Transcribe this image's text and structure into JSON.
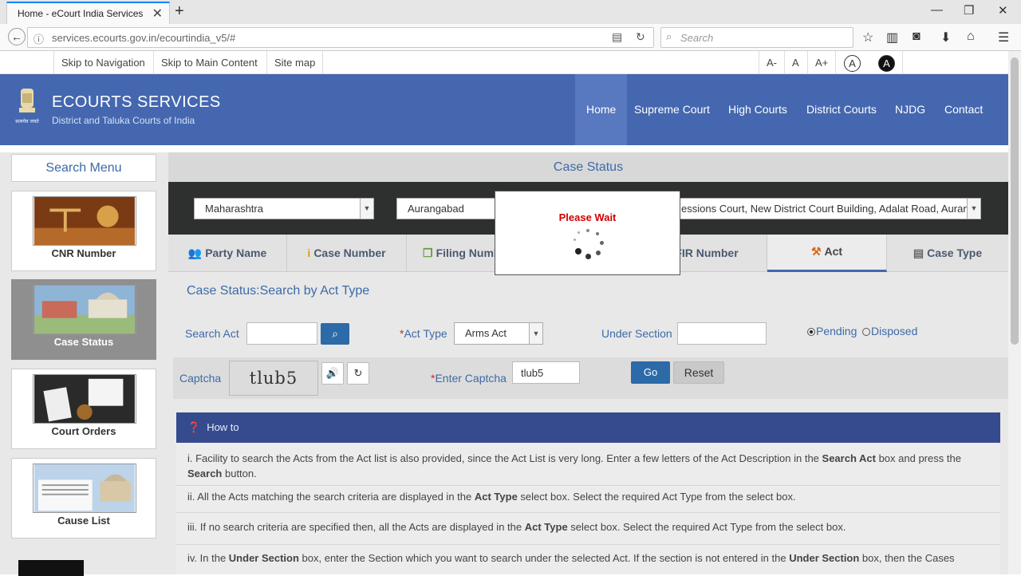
{
  "browser": {
    "tab_title": "Home - eCourt India Services",
    "url": "services.ecourts.gov.in/ecourtindia_v5/#",
    "search_placeholder": "Search"
  },
  "accessibility_bar": {
    "links": [
      "Skip to Navigation",
      "Skip to Main Content",
      "Site map"
    ],
    "font_sizes": [
      "A-",
      "A",
      "A+"
    ],
    "contrast_normal": "A",
    "contrast_high": "A"
  },
  "header": {
    "title": "ECOURTS SERVICES",
    "subtitle": "District and Taluka Courts of India",
    "emblem_caption": "सत्यमेव जयते",
    "menu": [
      "Home",
      "Supreme Court",
      "High Courts",
      "District Courts",
      "NJDG",
      "Contact Us"
    ],
    "bg_color": "#4467b0"
  },
  "sidebar": {
    "title": "Search Menu",
    "items": [
      {
        "label": "CNR Number",
        "active": false
      },
      {
        "label": "Case Status",
        "active": true
      },
      {
        "label": "Court Orders",
        "active": false
      },
      {
        "label": "Cause List",
        "active": false
      }
    ]
  },
  "main": {
    "title": "Case Status",
    "selects": {
      "state": "Maharashtra",
      "district": "Aurangabad",
      "complex": "essions Court, New District Court Building, Adalat Road, Auranga"
    },
    "tabs": [
      "Party Name",
      "Case Number",
      "Filing Number",
      "FIR Number",
      "Act",
      "Case Type"
    ],
    "active_tab": "Act",
    "heading": "Case Status:Search by Act Type",
    "form": {
      "search_act_label": "Search Act",
      "search_act_value": "",
      "act_type_label": "Act Type",
      "act_type_value": "Arms Act",
      "under_section_label": "Under Section",
      "under_section_value": "",
      "radio_pending": "Pending",
      "radio_disposed": "Disposed",
      "pending_selected": true,
      "captcha_label": "Captcha",
      "captcha_image_text": "tlub5",
      "enter_captcha_label": "Enter Captcha",
      "captcha_value": "tlub5",
      "go_label": "Go",
      "reset_label": "Reset"
    }
  },
  "howto": {
    "title": "How to",
    "items": [
      {
        "pre": "i. Facility to search the Acts from the Act list is also provided, since the Act List is very long. Enter a few letters of the Act Description in the ",
        "b1": "Search Act",
        "mid": " box and press the ",
        "b2": "Search",
        "post": " button."
      },
      {
        "pre": "ii. All the Acts matching the search criteria are displayed in the ",
        "b1": "Act Type",
        "post": " select box. Select the required Act Type from the select box."
      },
      {
        "pre": "iii. If no search criteria are specified then, all the Acts are displayed in the ",
        "b1": "Act Type",
        "post": " select box. Select the required Act Type from the select box."
      },
      {
        "pre": "iv. In the ",
        "b1": "Under Section",
        "mid": " box, enter the Section which you want to search under the selected Act. If the section is not entered in the ",
        "b2": "Under Section",
        "post": " box, then the Cases"
      }
    ]
  },
  "modal": {
    "text": "Please Wait"
  }
}
